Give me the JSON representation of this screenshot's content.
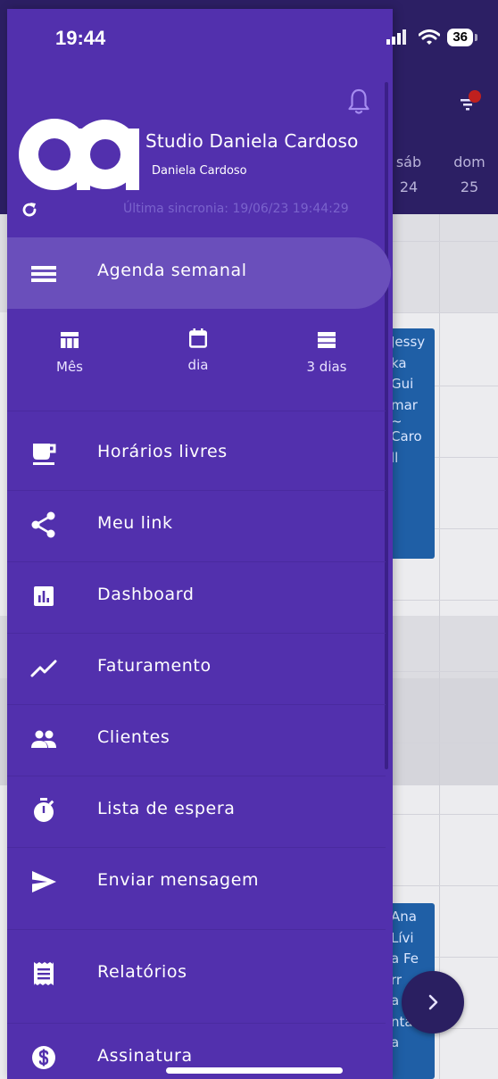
{
  "status_bar": {
    "time": "19:44",
    "battery": "36"
  },
  "drawer": {
    "studio_name": "Studio Daniela Cardoso",
    "user_name": "Daniela Cardoso",
    "sync_text": "Última sincronia: 19/06/23 19:44:29",
    "active_item": {
      "label": "Agenda semanal",
      "icon": "week-menu-icon"
    },
    "views": [
      {
        "label": "Mês",
        "icon": "month-view-icon"
      },
      {
        "label": "dia",
        "icon": "calendar-day-icon"
      },
      {
        "label": "3 dias",
        "icon": "three-days-icon"
      }
    ],
    "menu": [
      {
        "label": "Horários livres",
        "icon": "coffee-icon"
      },
      {
        "label": "Meu link",
        "icon": "share-icon"
      },
      {
        "label": "Dashboard",
        "icon": "dashboard-icon"
      },
      {
        "label": "Faturamento",
        "icon": "trending-up-icon"
      },
      {
        "label": "Clientes",
        "icon": "people-icon"
      },
      {
        "label": "Lista de espera",
        "icon": "timer-icon"
      },
      {
        "label": "Enviar mensagem",
        "icon": "send-icon"
      },
      {
        "label": "Relatórios",
        "icon": "receipt-icon"
      },
      {
        "label": "Assinatura",
        "icon": "dollar-icon"
      }
    ]
  },
  "background_calendar": {
    "days": [
      {
        "name": "sáb",
        "number": "24"
      },
      {
        "name": "dom",
        "number": "25"
      }
    ],
    "event_1_lines": [
      "Jessy",
      "ka",
      "Gui",
      "mar",
      "~",
      "Caro",
      "ll"
    ],
    "event_2_lines": [
      "Ana",
      "Lívi",
      "a Fe",
      "rr",
      "a",
      "ntan",
      "a"
    ]
  },
  "colors": {
    "drawer": "#5230ad",
    "active_item": "#6a4fbb",
    "header": "#2c1f64",
    "event": "#1f5fa6"
  }
}
